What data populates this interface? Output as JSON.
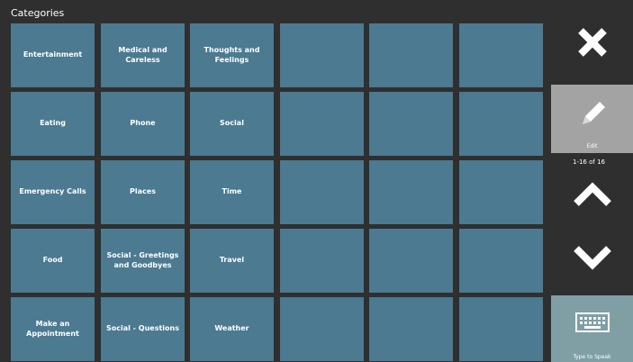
{
  "header": {
    "title": "Categories"
  },
  "tiles": [
    "Entertainment",
    "Medical and Careless",
    "Thoughts and Feelings",
    "",
    "",
    "",
    "Eating",
    "Phone",
    "Social",
    "",
    "",
    "",
    "Emergency Calls",
    "Places",
    "Time",
    "",
    "",
    "",
    "Food",
    "Social - Greetings and Goodbyes",
    "Travel",
    "",
    "",
    "",
    "Make an Appointment",
    "Social - Questions",
    "Weather",
    "",
    "",
    ""
  ],
  "sidebar": {
    "edit_label": "Edit",
    "page_counter": "1-16 of 16",
    "type_to_speak_label": "Type to Speak"
  },
  "icons": {
    "close": "close-icon",
    "edit": "pencil-icon",
    "up": "chevron-up-icon",
    "down": "chevron-down-icon",
    "keyboard": "keyboard-icon"
  },
  "colors": {
    "background": "#2f2f2f",
    "tile": "#4b7a91",
    "edit_button": "#a3a3a3",
    "type_to_speak_button": "#7f9fa5",
    "text": "#ffffff"
  }
}
